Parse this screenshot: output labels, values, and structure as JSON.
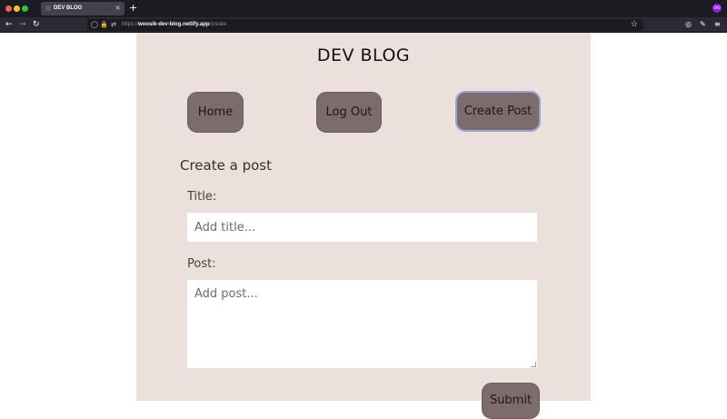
{
  "browser": {
    "tab_title": "DEV BLOG",
    "tab_close": "×",
    "new_tab": "+",
    "url_host": "woosik-dev-blog.netlify.app",
    "url_path": "/create",
    "url_scheme": "https://",
    "icons": {
      "back": "←",
      "forward": "→",
      "reload": "↻",
      "shield": "◯",
      "lock": "🔒",
      "permissions": "⇄",
      "bookmark": "☆",
      "pocket": "◎",
      "tools": "✎",
      "menu": "≡",
      "extension": "oo"
    }
  },
  "page": {
    "site_title": "DEV BLOG",
    "nav": {
      "home": "Home",
      "logout": "Log Out",
      "create": "Create Post"
    },
    "form": {
      "heading": "Create a post",
      "title_label": "Title:",
      "title_placeholder": "Add title...",
      "post_label": "Post:",
      "post_placeholder": "Add post...",
      "submit": "Submit"
    }
  },
  "colors": {
    "panel_bg": "#ebe0dc",
    "button_bg": "#7d6b6d",
    "focus_border": "#98a3d6"
  }
}
